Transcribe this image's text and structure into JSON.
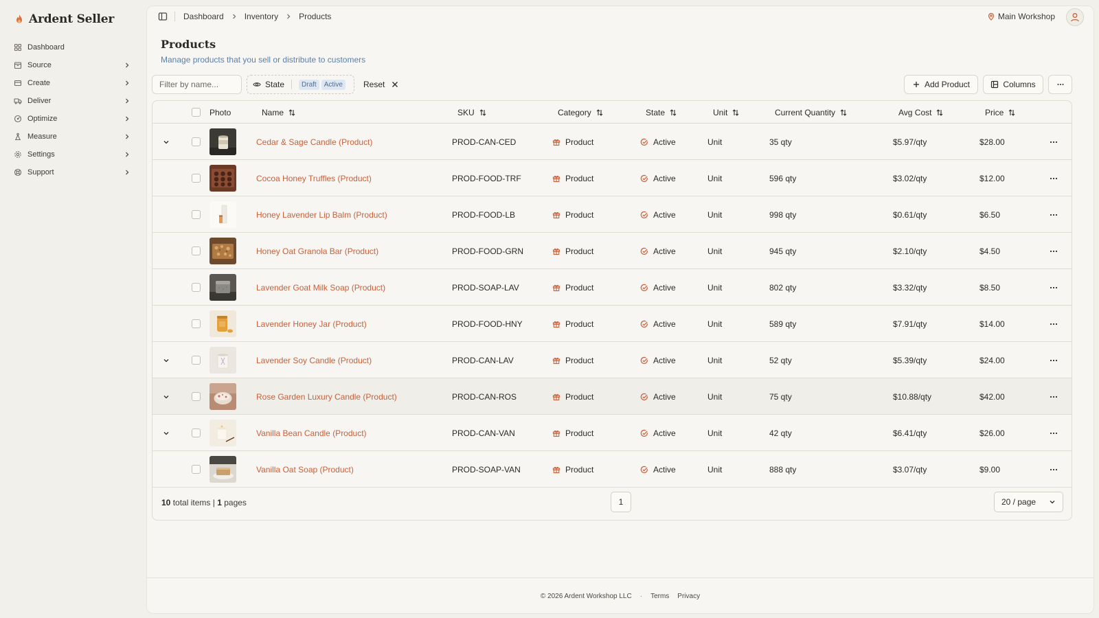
{
  "brand": {
    "name": "Ardent Seller",
    "accent": "#c8603a"
  },
  "sidebar": {
    "items": [
      {
        "label": "Dashboard",
        "icon": "dashboard-icon",
        "has_children": false
      },
      {
        "label": "Source",
        "icon": "box-icon",
        "has_children": true
      },
      {
        "label": "Create",
        "icon": "layers-icon",
        "has_children": true
      },
      {
        "label": "Deliver",
        "icon": "truck-icon",
        "has_children": true
      },
      {
        "label": "Optimize",
        "icon": "gauge-icon",
        "has_children": true
      },
      {
        "label": "Measure",
        "icon": "scale-icon",
        "has_children": true
      },
      {
        "label": "Settings",
        "icon": "gear-icon",
        "has_children": true
      },
      {
        "label": "Support",
        "icon": "lifebuoy-icon",
        "has_children": true
      }
    ]
  },
  "header": {
    "breadcrumbs": [
      "Dashboard",
      "Inventory",
      "Products"
    ],
    "location": "Main Workshop"
  },
  "page": {
    "title": "Products",
    "subtitle": "Manage products that you sell or distribute to customers"
  },
  "toolbar": {
    "filter_placeholder": "Filter by name...",
    "state_label": "State",
    "state_chips": [
      "Draft",
      "Active"
    ],
    "reset_label": "Reset",
    "add_label": "Add Product",
    "columns_label": "Columns"
  },
  "table": {
    "columns": {
      "photo": "Photo",
      "name": "Name",
      "sku": "SKU",
      "category": "Category",
      "state": "State",
      "unit": "Unit",
      "qty": "Current Quantity",
      "avg_cost": "Avg Cost",
      "price": "Price"
    },
    "rows": [
      {
        "expandable": true,
        "photo": "candle-dark",
        "name": "Cedar & Sage Candle (Product)",
        "sku": "PROD-CAN-CED",
        "category": "Product",
        "state": "Active",
        "unit": "Unit",
        "qty": "35 qty",
        "avg_cost": "$5.97/qty",
        "price": "$28.00"
      },
      {
        "expandable": false,
        "photo": "truffles",
        "name": "Cocoa Honey Truffles (Product)",
        "sku": "PROD-FOOD-TRF",
        "category": "Product",
        "state": "Active",
        "unit": "Unit",
        "qty": "596 qty",
        "avg_cost": "$3.02/qty",
        "price": "$12.00"
      },
      {
        "expandable": false,
        "photo": "lip-balm",
        "name": "Honey Lavender Lip Balm (Product)",
        "sku": "PROD-FOOD-LB",
        "category": "Product",
        "state": "Active",
        "unit": "Unit",
        "qty": "998 qty",
        "avg_cost": "$0.61/qty",
        "price": "$6.50"
      },
      {
        "expandable": false,
        "photo": "granola",
        "name": "Honey Oat Granola Bar (Product)",
        "sku": "PROD-FOOD-GRN",
        "category": "Product",
        "state": "Active",
        "unit": "Unit",
        "qty": "945 qty",
        "avg_cost": "$2.10/qty",
        "price": "$4.50"
      },
      {
        "expandable": false,
        "photo": "soap-grey",
        "name": "Lavender Goat Milk Soap (Product)",
        "sku": "PROD-SOAP-LAV",
        "category": "Product",
        "state": "Active",
        "unit": "Unit",
        "qty": "802 qty",
        "avg_cost": "$3.32/qty",
        "price": "$8.50"
      },
      {
        "expandable": false,
        "photo": "honey-jar",
        "name": "Lavender Honey Jar (Product)",
        "sku": "PROD-FOOD-HNY",
        "category": "Product",
        "state": "Active",
        "unit": "Unit",
        "qty": "589 qty",
        "avg_cost": "$7.91/qty",
        "price": "$14.00"
      },
      {
        "expandable": true,
        "photo": "candle-light",
        "name": "Lavender Soy Candle (Product)",
        "sku": "PROD-CAN-LAV",
        "category": "Product",
        "state": "Active",
        "unit": "Unit",
        "qty": "52 qty",
        "avg_cost": "$5.39/qty",
        "price": "$24.00"
      },
      {
        "expandable": true,
        "photo": "candle-rose",
        "name": "Rose Garden Luxury Candle (Product)",
        "sku": "PROD-CAN-ROS",
        "category": "Product",
        "state": "Active",
        "unit": "Unit",
        "qty": "75 qty",
        "avg_cost": "$10.88/qty",
        "price": "$42.00"
      },
      {
        "expandable": true,
        "photo": "candle-vanilla",
        "name": "Vanilla Bean Candle (Product)",
        "sku": "PROD-CAN-VAN",
        "category": "Product",
        "state": "Active",
        "unit": "Unit",
        "qty": "42 qty",
        "avg_cost": "$6.41/qty",
        "price": "$26.00"
      },
      {
        "expandable": false,
        "photo": "soap-oat",
        "name": "Vanilla Oat Soap (Product)",
        "sku": "PROD-SOAP-VAN",
        "category": "Product",
        "state": "Active",
        "unit": "Unit",
        "qty": "888 qty",
        "avg_cost": "$3.07/qty",
        "price": "$9.00"
      }
    ],
    "highlighted_row": 7
  },
  "pagination": {
    "total_items": "10",
    "total_items_label": "total items |",
    "pages": "1",
    "pages_label": "pages",
    "current_page": "1",
    "per_page": "20 / page"
  },
  "footer": {
    "copyright": "© 2026 Ardent Workshop LLC",
    "separator": "·",
    "terms": "Terms",
    "privacy": "Privacy"
  }
}
